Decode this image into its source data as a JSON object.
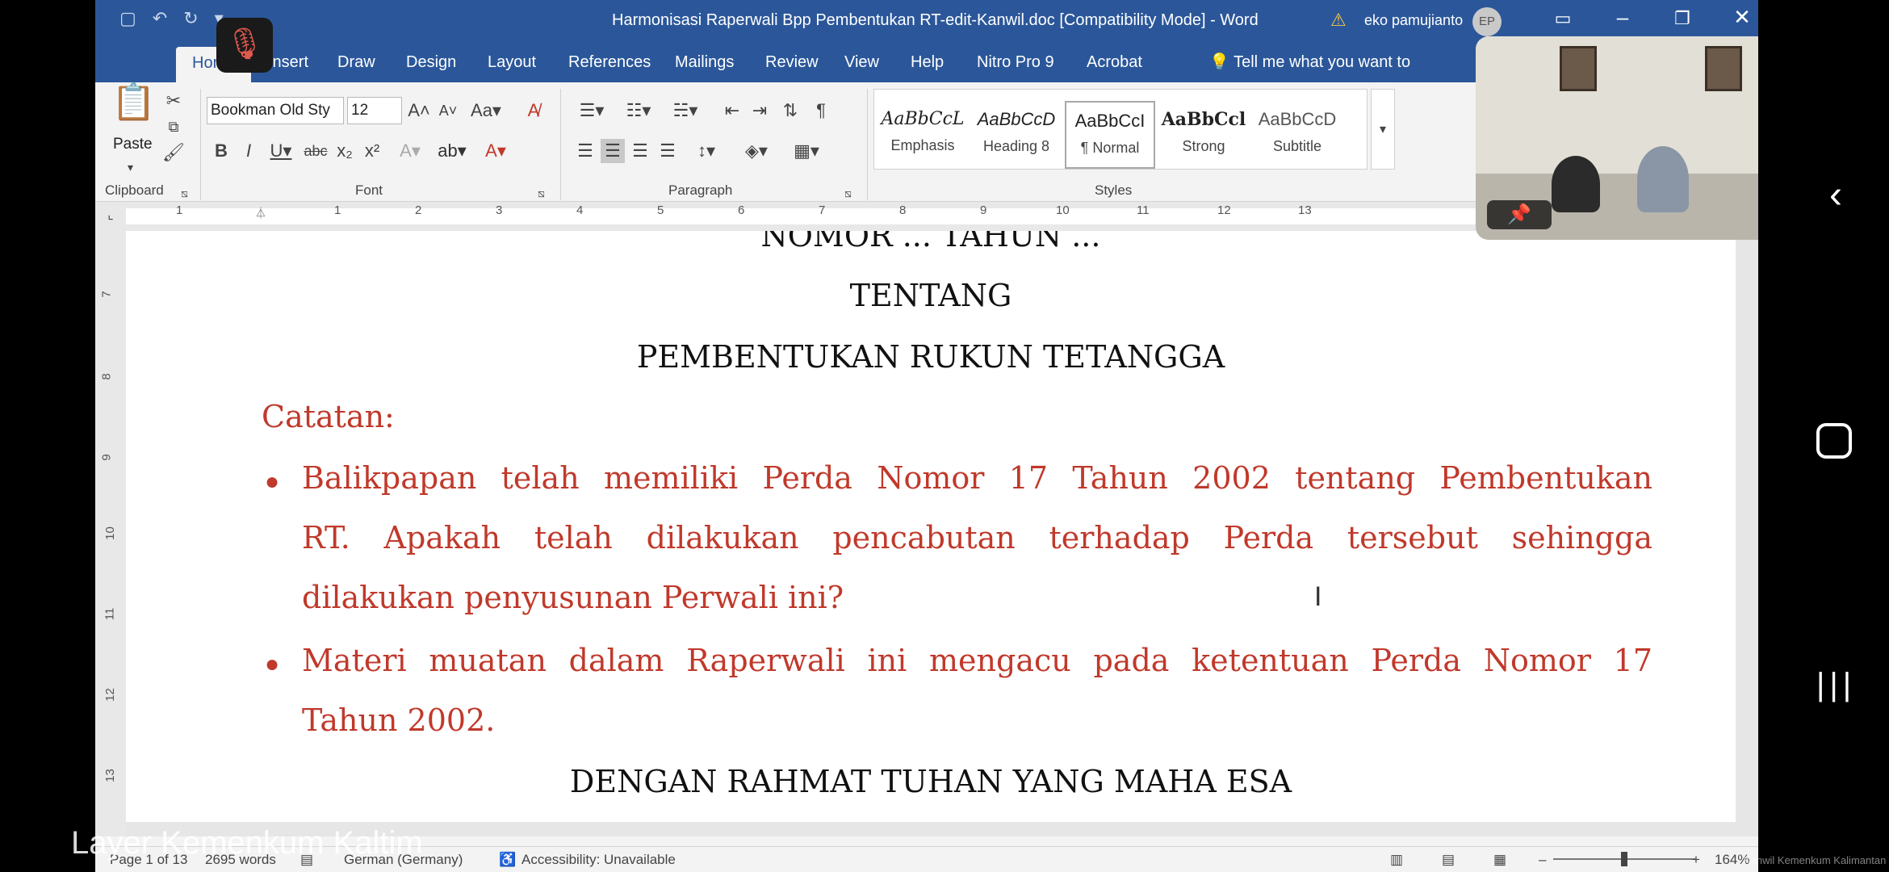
{
  "titlebar": {
    "doc_title": "Harmonisasi Raperwali Bpp Pembentukan RT-edit-Kanwil.doc [Compatibility Mode]  -  Word",
    "warning_icon": "warning-triangle-icon",
    "user_name": "eko pamujianto",
    "user_initials": "EP"
  },
  "tabs": [
    "Home",
    "Insert",
    "Draw",
    "Design",
    "Layout",
    "References",
    "Mailings",
    "Review",
    "View",
    "Help",
    "Nitro Pro 9",
    "Acrobat"
  ],
  "tell_me": "Tell me what you want to",
  "ribbon": {
    "clipboard": {
      "paste_label": "Paste",
      "group_label": "Clipboard"
    },
    "font": {
      "name": "Bookman Old Sty",
      "size": "12",
      "group_label": "Font"
    },
    "paragraph": {
      "group_label": "Paragraph"
    },
    "styles": {
      "group_label": "Styles",
      "items": [
        {
          "sample": "AaBbCcL",
          "name": "Emphasis"
        },
        {
          "sample": "AaBbCcD",
          "name": "Heading 8"
        },
        {
          "sample": "AaBbCcI",
          "name": "¶ Normal"
        },
        {
          "sample": "AaBbCcl",
          "name": "Strong"
        },
        {
          "sample": "AaBbCcD",
          "name": "Subtitle"
        }
      ]
    }
  },
  "ruler": {
    "h_numbers": [
      "1",
      "1",
      "2",
      "3",
      "4",
      "5",
      "6",
      "7",
      "8",
      "9",
      "10",
      "11",
      "12",
      "13"
    ],
    "v_numbers": [
      "7",
      "8",
      "9",
      "10",
      "11",
      "12",
      "13"
    ]
  },
  "document": {
    "line_nomor": "NOMOR ... TAHUN ...",
    "line_tentang": "TENTANG",
    "line_title": "PEMBENTUKAN RUKUN TETANGGA",
    "catatan": "Catatan:",
    "bullet1_lines": [
      "Balikpapan telah memiliki Perda Nomor 17 Tahun 2002 tentang Pembentukan",
      "RT. Apakah telah dilakukan pencabutan terhadap Perda tersebut sehingga",
      "dilakukan penyusunan Perwali ini?"
    ],
    "bullet2_lines": [
      "Materi muatan dalam Raperwali ini mengacu pada ketentuan Perda Nomor 17",
      "Tahun 2002."
    ],
    "line_rahmat": "DENGAN RAHMAT TUHAN YANG MAHA ESA"
  },
  "statusbar": {
    "page": "Page 1 of 13",
    "words": "2695 words",
    "language": "German (Germany)",
    "accessibility": "Accessibility: Unavailable",
    "zoom": "164%"
  },
  "overlay": {
    "watermark": "Layer Kemenkum Kaltim",
    "watermark_small": "Kanwil Kemenkum Kalimantan Timur"
  }
}
